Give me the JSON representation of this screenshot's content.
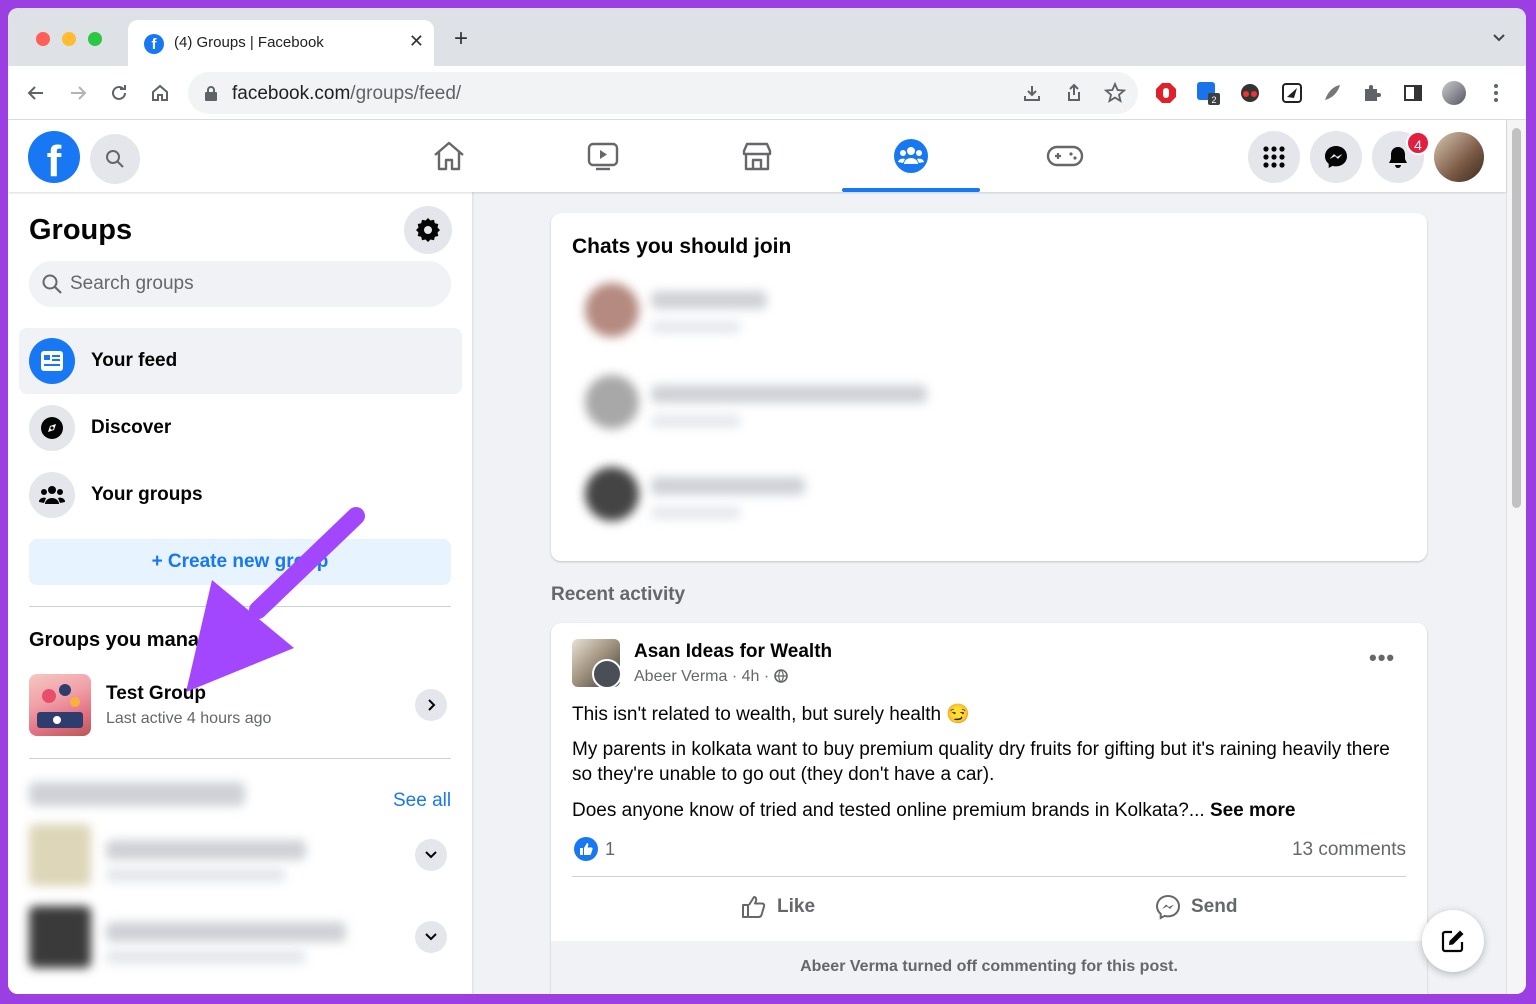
{
  "browser": {
    "tab_title": "(4) Groups | Facebook",
    "url_host": "facebook.com",
    "url_path": "/groups/feed/",
    "extension_badge": "2"
  },
  "header": {
    "notification_count": "4",
    "nav_icons": [
      "home-icon",
      "watch-icon",
      "marketplace-icon",
      "groups-icon",
      "gaming-icon"
    ],
    "active_nav": "groups-icon",
    "accent": "#1877f2"
  },
  "sidebar": {
    "title": "Groups",
    "search_placeholder": "Search groups",
    "items": [
      {
        "label": "Your feed",
        "icon": "feed-icon",
        "active": true
      },
      {
        "label": "Discover",
        "icon": "compass-icon",
        "active": false
      },
      {
        "label": "Your groups",
        "icon": "people-icon",
        "active": false
      }
    ],
    "create_button": "+ Create new group",
    "managed_title": "Groups you manage",
    "managed_group": {
      "name": "Test Group",
      "subtitle": "Last active 4 hours ago"
    },
    "see_all": "See all"
  },
  "main": {
    "chats_title": "Chats you should join",
    "recent_title": "Recent activity",
    "post": {
      "group": "Asan Ideas for Wealth",
      "author": "Abeer Verma",
      "time": "4h",
      "line1": "This isn't related to wealth, but surely health 😏",
      "line2": "My parents in kolkata want to buy premium quality dry fruits for gifting but it's raining heavily there so they're unable to go out (they don't have a car).",
      "line3": "Does anyone know of tried and tested online premium brands in Kolkata?...",
      "see_more": "See more",
      "likes": "1",
      "comments": "13 comments",
      "like_label": "Like",
      "send_label": "Send",
      "footer_note": "Abeer Verma turned off commenting for this post."
    }
  }
}
